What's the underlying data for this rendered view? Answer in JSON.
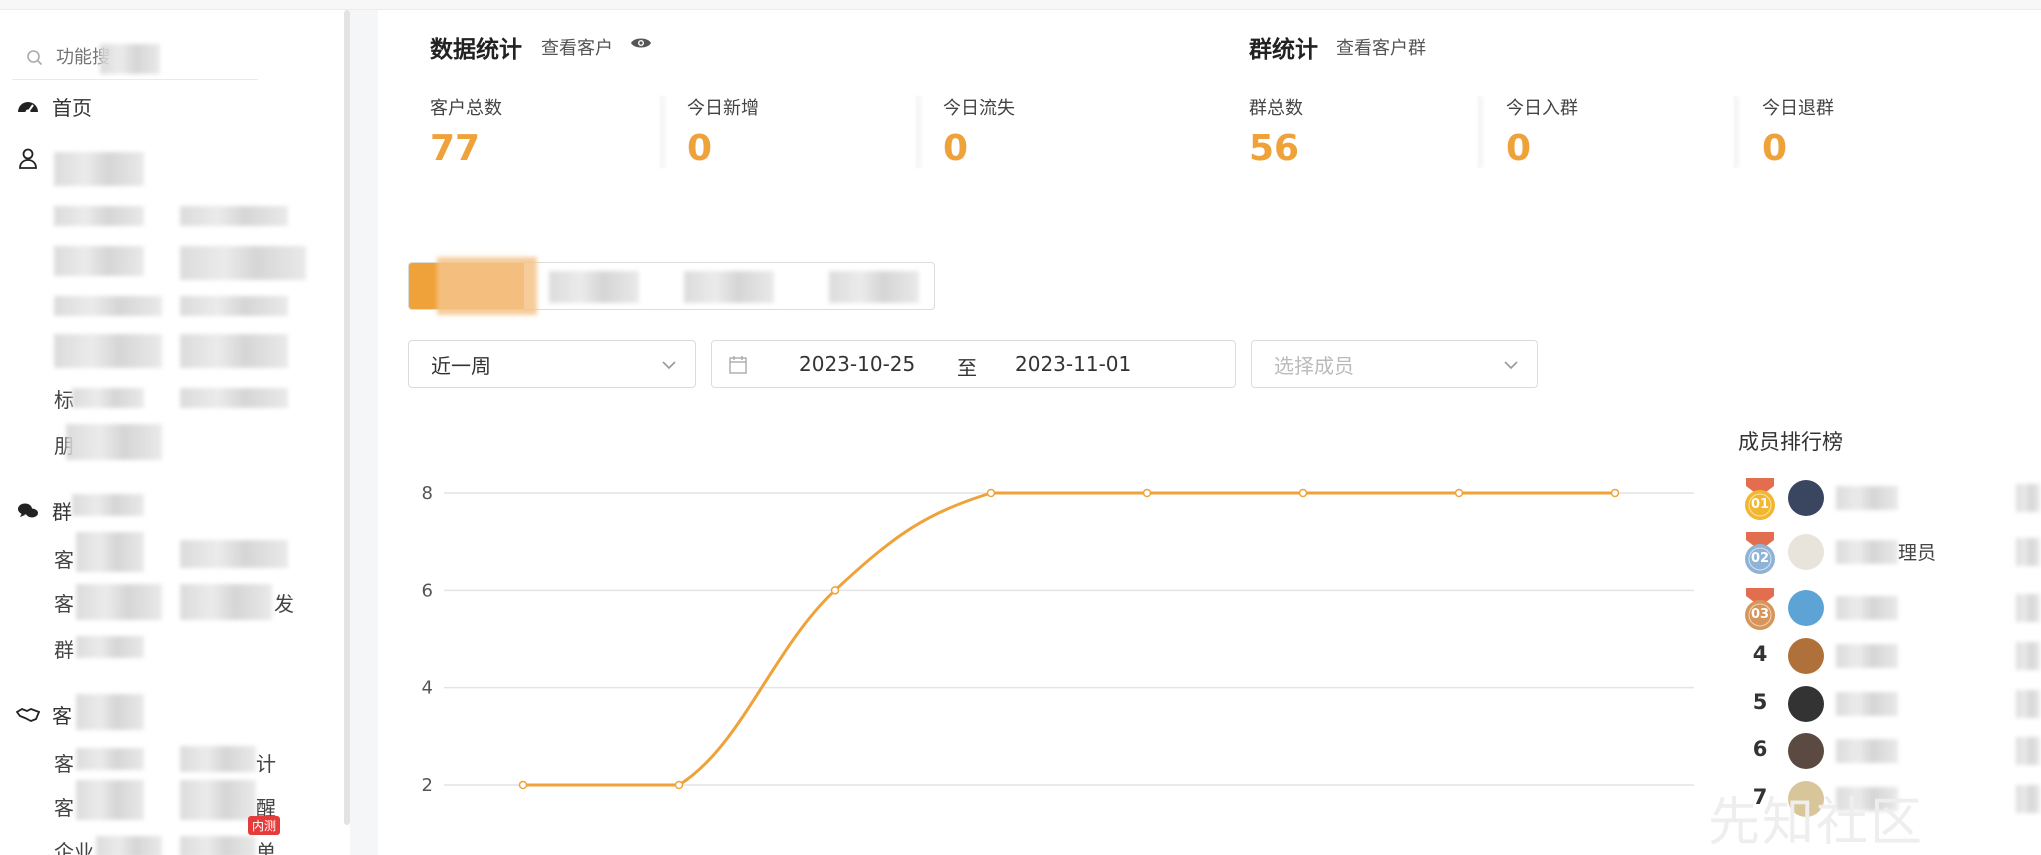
{
  "sidebar": {
    "search_placeholder": "功能搜",
    "home": "首页",
    "customer_section": "客",
    "group_section": "群",
    "group_sub1": "客",
    "group_sub2": "客",
    "group_sub2b": "发",
    "group_sub3": "群",
    "cust_section": "客",
    "cust_sub1": "客",
    "cust_sub1b": "计",
    "cust_sub2": "客",
    "cust_sub2b": "醒",
    "cust_sub3": "企业",
    "cust_sub3b": "单",
    "l1": "标",
    "l2": "朋",
    "badge": "内测"
  },
  "stats": {
    "title": "数据统计",
    "link": "查看客户",
    "items": [
      {
        "label": "客户总数",
        "value": "77"
      },
      {
        "label": "今日新增",
        "value": "0"
      },
      {
        "label": "今日流失",
        "value": "0"
      }
    ]
  },
  "group_stats": {
    "title": "群统计",
    "link": "查看客户群",
    "items": [
      {
        "label": "群总数",
        "value": "56"
      },
      {
        "label": "今日入群",
        "value": "0"
      },
      {
        "label": "今日退群",
        "value": "0"
      }
    ]
  },
  "filters": {
    "period": "近一周",
    "date_from": "2023-10-25",
    "date_sep": "至",
    "date_to": "2023-11-01",
    "member_placeholder": "选择成员"
  },
  "ranking": {
    "title": "成员排行榜",
    "rows": [
      {
        "rank": "01",
        "name": ""
      },
      {
        "rank": "02",
        "name": "理员"
      },
      {
        "rank": "03",
        "name": ""
      },
      {
        "rank": "4",
        "name": ""
      },
      {
        "rank": "5",
        "name": ""
      },
      {
        "rank": "6",
        "name": ""
      },
      {
        "rank": "7",
        "name": ""
      }
    ]
  },
  "watermark": "先知社区",
  "colors": {
    "accent": "#f0a23a",
    "grid": "#e4e4e4"
  },
  "chart_data": {
    "type": "line",
    "x": [
      "",
      "",
      "",
      "",
      "",
      "",
      "",
      ""
    ],
    "series": [
      {
        "values": [
          2,
          2,
          6,
          8,
          8,
          8,
          8,
          8
        ]
      }
    ],
    "yticks": [
      "2",
      "4",
      "6",
      "8"
    ],
    "ylim": [
      2,
      8
    ],
    "grid": true
  }
}
